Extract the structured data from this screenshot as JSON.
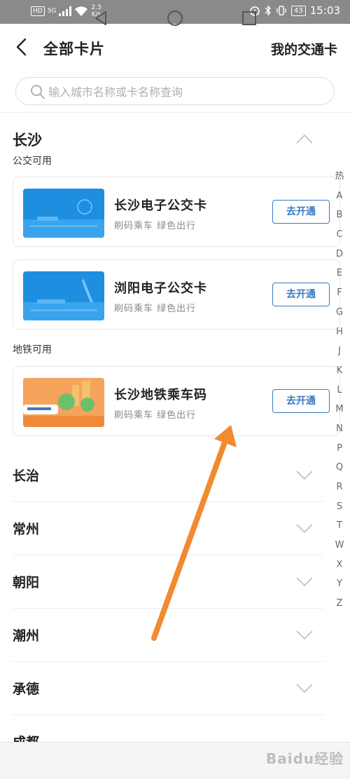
{
  "status_bar": {
    "network": "HD",
    "signal": "5G",
    "speed_value": "2.3",
    "speed_unit": "K/s",
    "battery": "43",
    "time": "15:03"
  },
  "header": {
    "title": "全部卡片",
    "right_link": "我的交通卡"
  },
  "search": {
    "placeholder": "输入城市名称或卡名称查询"
  },
  "expanded_city": {
    "name": "长沙",
    "bus_label": "公交可用",
    "metro_label": "地铁可用",
    "cards": [
      {
        "name": "长沙电子公交卡",
        "desc": "刷码乘车 绿色出行",
        "button": "去开通"
      },
      {
        "name": "浏阳电子公交卡",
        "desc": "刷码乘车 绿色出行",
        "button": "去开通"
      },
      {
        "name": "长沙地铁乘车码",
        "desc": "刷码乘车 绿色出行",
        "button": "去开通"
      }
    ]
  },
  "cities": [
    "长治",
    "常州",
    "朝阳",
    "潮州",
    "承德",
    "成都"
  ],
  "index_bar": [
    "热",
    "A",
    "B",
    "C",
    "D",
    "E",
    "F",
    "G",
    "H",
    "J",
    "K",
    "L",
    "M",
    "N",
    "P",
    "Q",
    "R",
    "S",
    "T",
    "W",
    "X",
    "Y",
    "Z"
  ],
  "watermark": "Baidu经验",
  "colors": {
    "accent": "#3a78c4",
    "status_bar": "#8a8a8a",
    "arrow": "#f28a30"
  }
}
